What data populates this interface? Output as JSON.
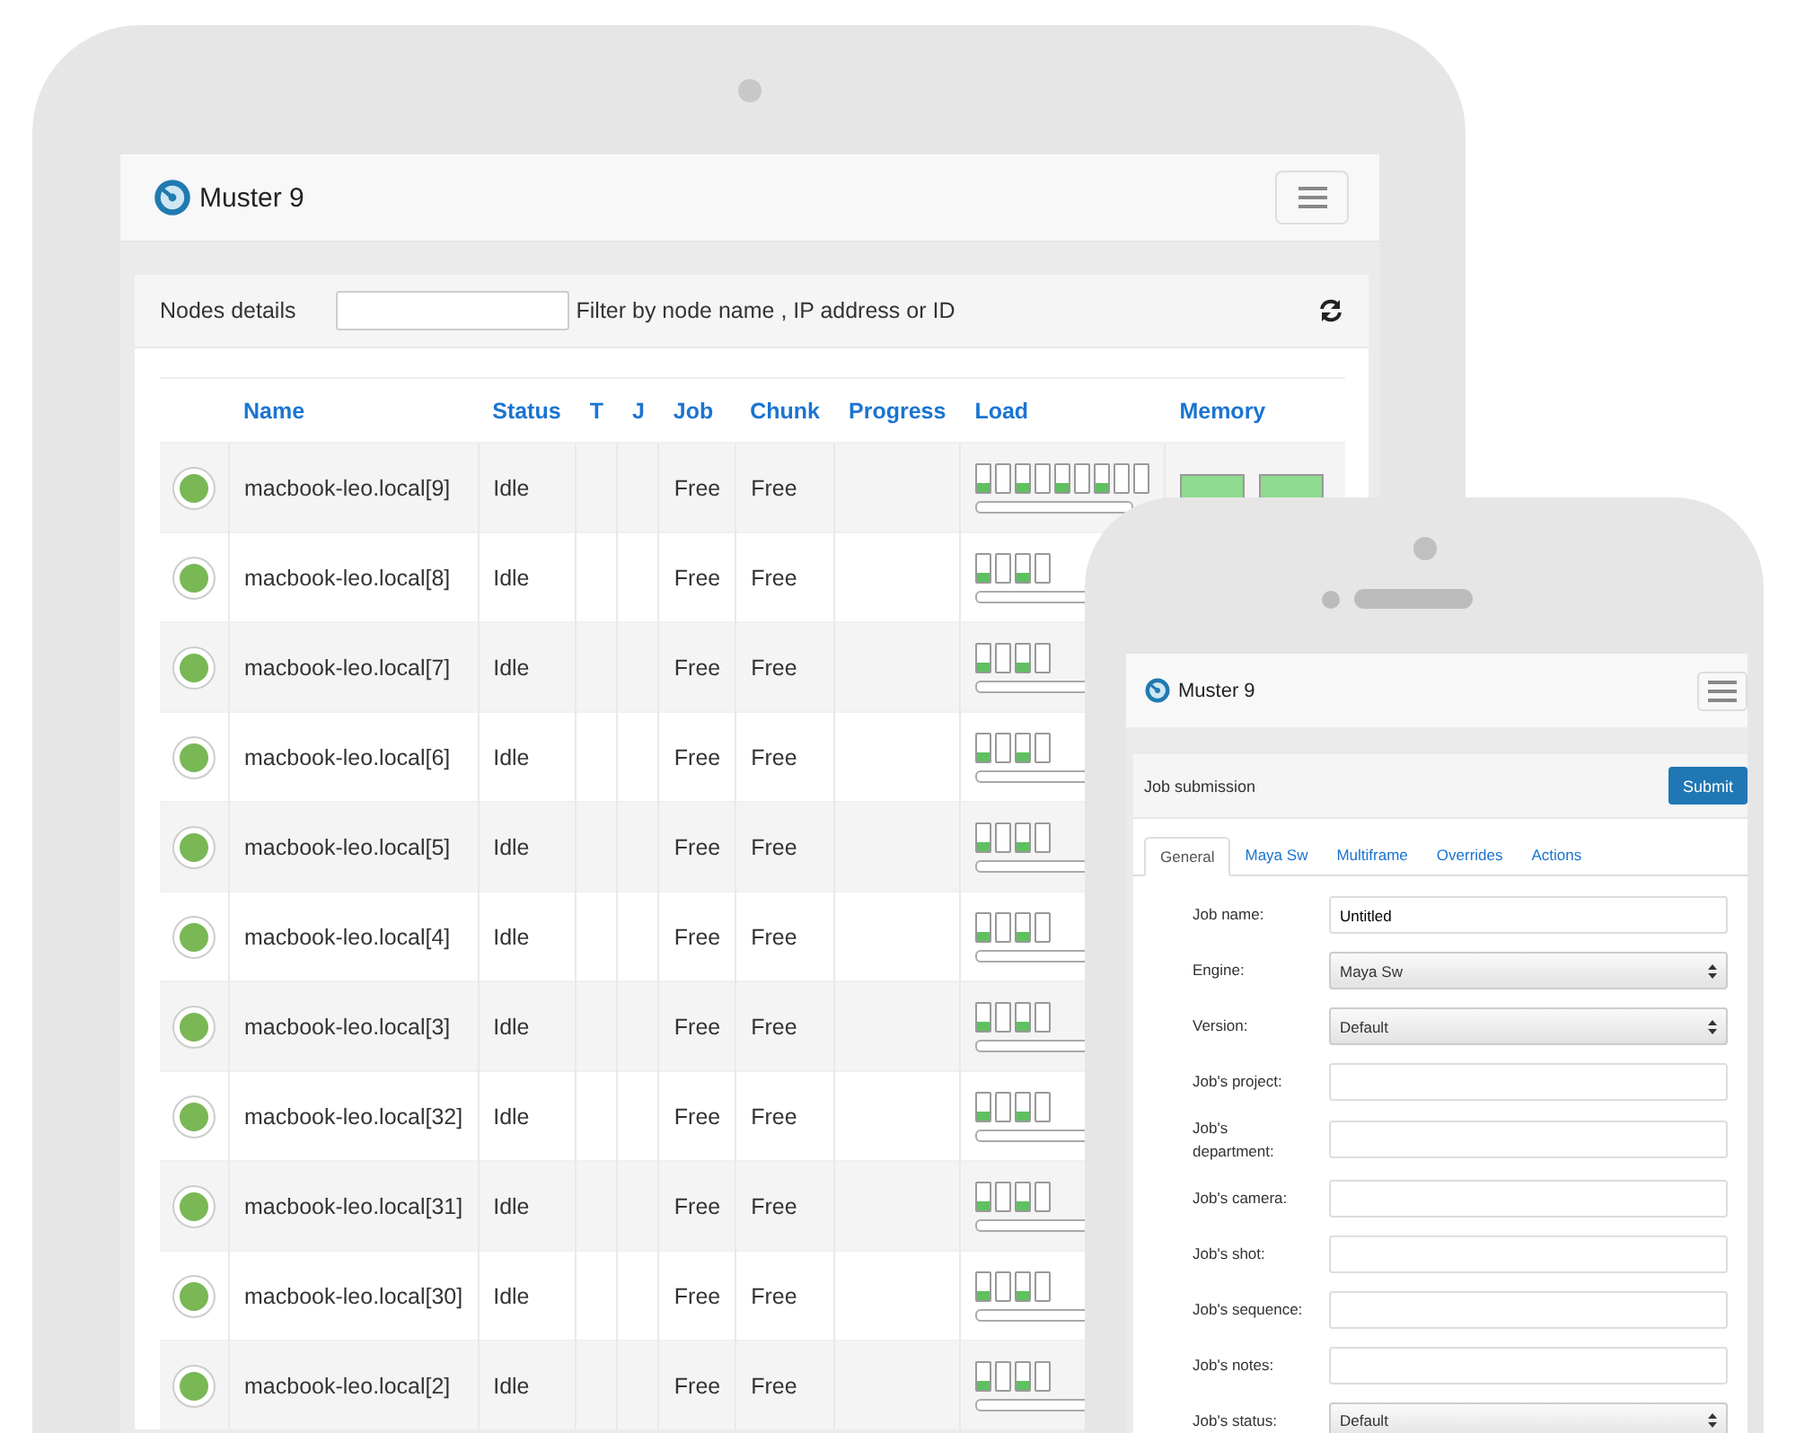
{
  "tablet": {
    "brand": "Muster 9",
    "panel_title": "Nodes details",
    "filter_hint": "Filter by node name , IP address or ID",
    "columns": [
      "Name",
      "Status",
      "T",
      "J",
      "Job",
      "Chunk",
      "Progress",
      "Load",
      "Memory"
    ],
    "rows": [
      {
        "name": "macbook-leo.local[9]",
        "status": "Idle",
        "job": "Free",
        "chunk": "Free",
        "load": [
          {
            "level": 0.3
          },
          {
            "level": 0
          },
          {
            "level": 0.3
          },
          {
            "level": 0
          },
          {
            "level": 0.3
          },
          {
            "level": 0
          },
          {
            "level": 0.3
          },
          {
            "level": 0
          },
          {
            "level": 0
          }
        ],
        "load_bar": {
          "level": 0
        },
        "memory": [
          {
            "level": 1
          },
          {
            "level": 1
          }
        ]
      },
      {
        "name": "macbook-leo.local[8]",
        "status": "Idle",
        "job": "Free",
        "chunk": "Free",
        "load": [
          {
            "level": 0.3
          },
          {
            "level": 0
          },
          {
            "level": 0.3
          },
          {
            "level": 0
          }
        ],
        "load_bar": {
          "level": 0
        }
      },
      {
        "name": "macbook-leo.local[7]",
        "status": "Idle",
        "job": "Free",
        "chunk": "Free",
        "load": [
          {
            "level": 0.3
          },
          {
            "level": 0
          },
          {
            "level": 0.3
          },
          {
            "level": 0
          }
        ],
        "load_bar": {
          "level": 0
        }
      },
      {
        "name": "macbook-leo.local[6]",
        "status": "Idle",
        "job": "Free",
        "chunk": "Free",
        "load": [
          {
            "level": 0.3
          },
          {
            "level": 0
          },
          {
            "level": 0.3
          },
          {
            "level": 0
          }
        ],
        "load_bar": {
          "level": 0
        }
      },
      {
        "name": "macbook-leo.local[5]",
        "status": "Idle",
        "job": "Free",
        "chunk": "Free",
        "load": [
          {
            "level": 0.3
          },
          {
            "level": 0
          },
          {
            "level": 0.3
          },
          {
            "level": 0
          }
        ],
        "load_bar": {
          "level": 0
        }
      },
      {
        "name": "macbook-leo.local[4]",
        "status": "Idle",
        "job": "Free",
        "chunk": "Free",
        "load": [
          {
            "level": 0.3
          },
          {
            "level": 0
          },
          {
            "level": 0.3
          },
          {
            "level": 0
          }
        ],
        "load_bar": {
          "level": 0
        }
      },
      {
        "name": "macbook-leo.local[3]",
        "status": "Idle",
        "job": "Free",
        "chunk": "Free",
        "load": [
          {
            "level": 0.3
          },
          {
            "level": 0
          },
          {
            "level": 0.3
          },
          {
            "level": 0
          }
        ],
        "load_bar": {
          "level": 0
        }
      },
      {
        "name": "macbook-leo.local[32]",
        "status": "Idle",
        "job": "Free",
        "chunk": "Free",
        "load": [
          {
            "level": 0.3
          },
          {
            "level": 0
          },
          {
            "level": 0.3
          },
          {
            "level": 0
          }
        ],
        "load_bar": {
          "level": 0
        }
      },
      {
        "name": "macbook-leo.local[31]",
        "status": "Idle",
        "job": "Free",
        "chunk": "Free",
        "load": [
          {
            "level": 0.3
          },
          {
            "level": 0
          },
          {
            "level": 0.3
          },
          {
            "level": 0
          }
        ],
        "load_bar": {
          "level": 0
        }
      },
      {
        "name": "macbook-leo.local[30]",
        "status": "Idle",
        "job": "Free",
        "chunk": "Free",
        "load": [
          {
            "level": 0.3
          },
          {
            "level": 0
          },
          {
            "level": 0.3
          },
          {
            "level": 0
          }
        ],
        "load_bar": {
          "level": 0
        }
      },
      {
        "name": "macbook-leo.local[2]",
        "status": "Idle",
        "job": "Free",
        "chunk": "Free",
        "load": [
          {
            "level": 0.3
          },
          {
            "level": 0
          },
          {
            "level": 0.3
          },
          {
            "level": 0
          }
        ],
        "load_bar": {
          "level": 0
        }
      }
    ]
  },
  "phone": {
    "brand": "Muster 9",
    "panel_title": "Job submission",
    "submit": "Submit",
    "tabs": [
      {
        "label": "General",
        "selected": true
      },
      {
        "label": "Maya Sw",
        "selected": false
      },
      {
        "label": "Multiframe",
        "selected": false
      },
      {
        "label": "Overrides",
        "selected": false
      },
      {
        "label": "Actions",
        "selected": false
      }
    ],
    "fields": [
      {
        "label": "Job name:",
        "kind": "text",
        "value": "Untitled"
      },
      {
        "label": "Engine:",
        "kind": "select",
        "value": "Maya Sw"
      },
      {
        "label": "Version:",
        "kind": "select",
        "value": "Default"
      },
      {
        "label": "Job's project:",
        "kind": "text"
      },
      {
        "label": "Job's department:",
        "kind": "text"
      },
      {
        "label": "Job's camera:",
        "kind": "text"
      },
      {
        "label": "Job's shot:",
        "kind": "text"
      },
      {
        "label": "Job's sequence:",
        "kind": "text"
      },
      {
        "label": "Job's notes:",
        "kind": "text"
      },
      {
        "label": "Job's status:",
        "kind": "select",
        "value": "Default"
      }
    ]
  }
}
